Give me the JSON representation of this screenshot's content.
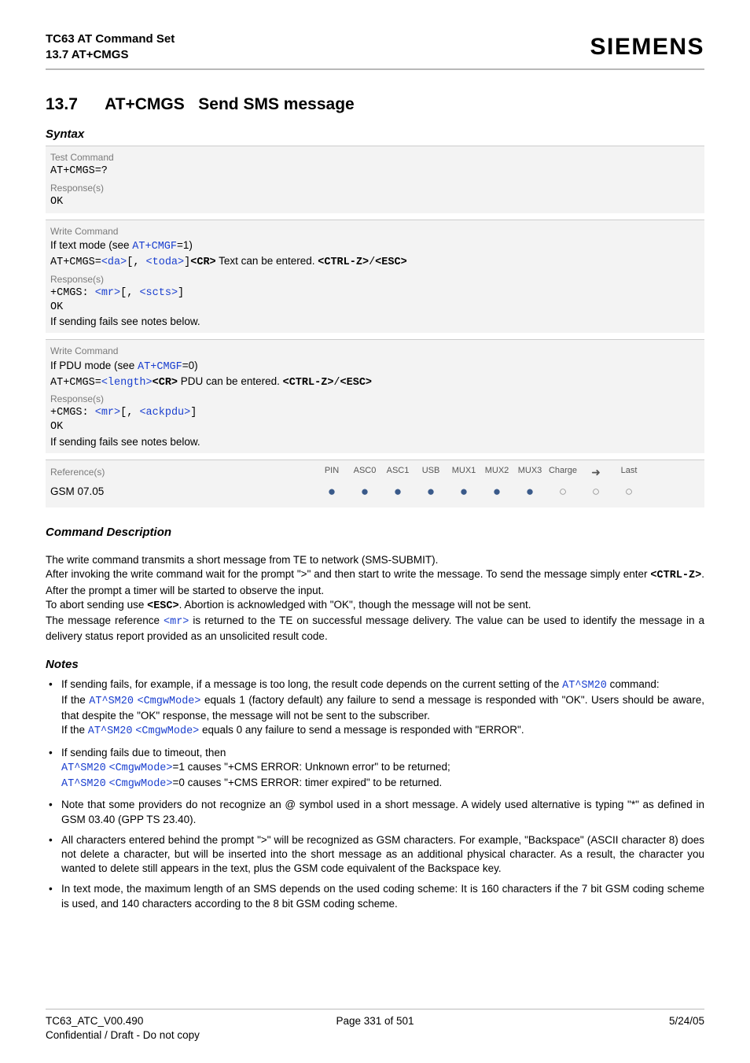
{
  "header": {
    "title1": "TC63 AT Command Set",
    "title2": "13.7 AT+CMGS",
    "brand": "SIEMENS"
  },
  "section": {
    "number": "13.7",
    "title_cmd": "AT+CMGS",
    "title_rest": "Send SMS message"
  },
  "labels": {
    "syntax": "Syntax",
    "test_command": "Test Command",
    "write_command": "Write Command",
    "responses": "Response(s)",
    "references": "Reference(s)",
    "command_desc": "Command Description",
    "notes": "Notes"
  },
  "test": {
    "cmd": "AT+CMGS=?",
    "resp": "OK"
  },
  "write1": {
    "intro_pre": "If text mode (see ",
    "intro_link": "AT+CMGF",
    "intro_post": "=1)",
    "line_pre": "AT+CMGS=",
    "p_da": "<da>",
    "sep": "[, ",
    "p_toda": "<toda>",
    "bracket": "]",
    "cr": "<CR>",
    "text_ent": " Text can be entered. ",
    "ctrlz": "<CTRL-Z>",
    "slash": "/",
    "esc": "<ESC>",
    "r1_pre": "+CMGS: ",
    "r1_mr": "<mr>",
    "r1_sep": "[, ",
    "r1_scts": "<scts>",
    "r1_end": "]",
    "r2": "OK",
    "r3": "If sending fails see notes below."
  },
  "write2": {
    "intro_pre": "If PDU mode (see ",
    "intro_link": "AT+CMGF",
    "intro_post": "=0)",
    "line_pre": "AT+CMGS=",
    "p_len": "<length>",
    "cr": "<CR>",
    "text_ent": " PDU can be entered. ",
    "ctrlz": "<CTRL-Z>",
    "slash": "/",
    "esc": "<ESC>",
    "r1_pre": "+CMGS: ",
    "r1_mr": "<mr>",
    "r1_sep": "[, ",
    "r1_ack": "<ackpdu>",
    "r1_end": "]",
    "r2": "OK",
    "r3": "If sending fails see notes below."
  },
  "ref": {
    "cols": [
      "PIN",
      "ASC0",
      "ASC1",
      "USB",
      "MUX1",
      "MUX2",
      "MUX3",
      "Charge",
      "➜",
      "Last"
    ],
    "value": "GSM 07.05",
    "dots": [
      "filled",
      "filled",
      "filled",
      "filled",
      "filled",
      "filled",
      "filled",
      "open",
      "open",
      "open"
    ]
  },
  "description": {
    "p1": "The write command transmits a short message from TE to network (SMS-SUBMIT).",
    "p2a": "After invoking the write command wait for the prompt \">\" and then start to write the message. To send the message simply enter ",
    "p2b": "<CTRL-Z>",
    "p2c": ". After the prompt a timer will be started to observe the input.",
    "p3a": "To abort sending use ",
    "p3b": "<ESC>",
    "p3c": ". Abortion is acknowledged with \"OK\", though the message will not be sent.",
    "p4a": "The message reference ",
    "p4b": "<mr>",
    "p4c": " is returned to the TE on successful message delivery. The value can be used to identify the message in a delivery status report provided as an unsolicited result code."
  },
  "notes": {
    "n1a": "If sending fails, for example, if a message is too long, the result code depends on the current setting of the ",
    "n1b": "AT^SM20",
    "n1c": " command:",
    "n1d": "If the ",
    "n1e": "AT^SM20",
    "n1f": " ",
    "n1g": "<CmgwMode>",
    "n1h": " equals 1 (factory default) any failure to send a message is responded with \"OK\". Users should be aware, that despite the \"OK\" response, the message will not be sent to the subscriber.",
    "n1i": "If the ",
    "n1j": "AT^SM20",
    "n1k": " ",
    "n1l": "<CmgwMode>",
    "n1m": " equals 0 any failure to send a message is responded with \"ERROR\".",
    "n2a": "If sending fails due to timeout, then",
    "n2b": "AT^SM20",
    "n2c": " ",
    "n2d": "<CmgwMode>",
    "n2e": "=1 causes \"+CMS ERROR: Unknown error\" to be returned;",
    "n2f": "AT^SM20",
    "n2g": " ",
    "n2h": "<CmgwMode>",
    "n2i": "=0 causes \"+CMS ERROR: timer expired\" to be returned.",
    "n3": "Note that some providers do not recognize an @ symbol used in a short message. A widely used alternative is typing \"*\" as defined in GSM 03.40 (GPP TS 23.40).",
    "n4": "All characters entered behind the prompt \">\" will be recognized as GSM characters. For example, \"Backspace\" (ASCII character 8) does not delete a character, but will be inserted into the short message as an additional physical character. As a result, the character you wanted to delete still appears in the text, plus the GSM code equivalent of the Backspace key.",
    "n5": "In text mode, the maximum length of an SMS depends on the used coding scheme: It is 160 characters if the 7 bit GSM coding scheme is used, and 140 characters according to the 8 bit GSM coding scheme."
  },
  "footer": {
    "left1": "TC63_ATC_V00.490",
    "left2": "Confidential / Draft - Do not copy",
    "center": "Page 331 of 501",
    "right": "5/24/05"
  }
}
